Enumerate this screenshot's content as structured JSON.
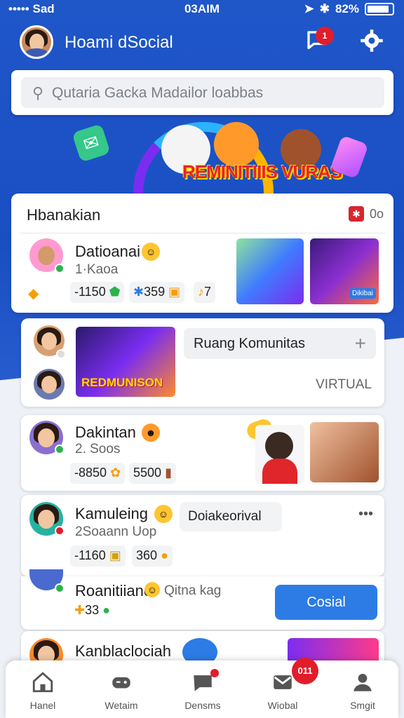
{
  "status_bar": {
    "carrier": "••••• Sad",
    "time": "03AIM",
    "battery": "82%"
  },
  "header": {
    "title": "Hoami dSocial",
    "notification_count": "1"
  },
  "search": {
    "placeholder": "Qutaria Gacka Madailor loabbas"
  },
  "banner": {
    "title": "REMINITIIIS VURAS"
  },
  "main_section": {
    "title": "Hbanakian",
    "right_label": "0o"
  },
  "posts": [
    {
      "name": "Datioanai",
      "sub": "1·Kaoa",
      "stats": [
        "-1150",
        "359",
        "7"
      ],
      "thumb2_label": "Dikibai"
    },
    {
      "pill": "Ruang Komunitas",
      "plus": "+",
      "tag": "VIRTUAL",
      "banner": "REDMUNISON"
    },
    {
      "name": "Dakintan",
      "sub": "2. Soos",
      "stats": [
        "-8850",
        "5500"
      ]
    },
    {
      "name": "Kamuleing",
      "sub": "2Soaann Uop",
      "stats": [
        "-1160",
        "360"
      ],
      "pill": "Doiakeorival",
      "more": "•••"
    },
    {
      "name": "Roanitiianc",
      "sub_inline": "Qitna kag",
      "stats": [
        "33"
      ],
      "button": "Cosial"
    },
    {
      "name": "Kanblaclociah"
    }
  ],
  "bottom_nav": {
    "items": [
      {
        "label": "Hanel",
        "icon": "home-icon"
      },
      {
        "label": "Wetaim",
        "icon": "gamepad-icon"
      },
      {
        "label": "Densms",
        "icon": "chat-icon"
      },
      {
        "label": "Wiobal",
        "icon": "mail-icon",
        "badge": "011"
      },
      {
        "label": "Smgit",
        "icon": "profile-icon"
      }
    ]
  },
  "colors": {
    "primary": "#1f56c8",
    "button": "#2d7be5",
    "badge": "#e11d2a"
  }
}
